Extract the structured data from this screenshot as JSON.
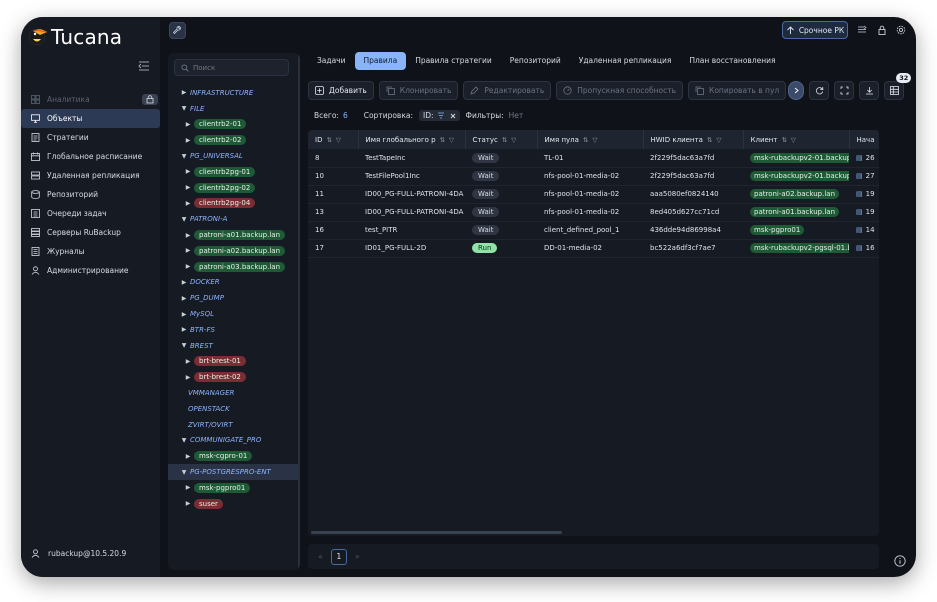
{
  "app": {
    "name": "Tucana"
  },
  "sidebar": {
    "items": [
      {
        "label": "Аналитика",
        "icon": "analytics-icon",
        "disabled": true
      },
      {
        "label": "Объекты",
        "icon": "monitor-icon",
        "active": true
      },
      {
        "label": "Стратегии",
        "icon": "document-icon"
      },
      {
        "label": "Глобальное расписание",
        "icon": "calendar-icon"
      },
      {
        "label": "Удаленная репликация",
        "icon": "server-icon"
      },
      {
        "label": "Репозиторий",
        "icon": "database-icon"
      },
      {
        "label": "Очереди задач",
        "icon": "queue-icon"
      },
      {
        "label": "Серверы RuBackup",
        "icon": "servers-icon"
      },
      {
        "label": "Журналы",
        "icon": "log-icon"
      },
      {
        "label": "Администрирование",
        "icon": "admin-icon"
      }
    ],
    "user": "rubackup@10.5.20.9"
  },
  "topbar": {
    "urgent_label": "Срочное РК"
  },
  "tree": {
    "search_placeholder": "Поиск",
    "nodes": [
      {
        "type": "group",
        "label": "INFRASTRUCTURE",
        "expanded": false
      },
      {
        "type": "group",
        "label": "FILE",
        "expanded": true
      },
      {
        "type": "child",
        "label": "clientrb2-01",
        "color": "green"
      },
      {
        "type": "child",
        "label": "clientrb2-02",
        "color": "green"
      },
      {
        "type": "group",
        "label": "PG_UNIVERSAL",
        "expanded": true
      },
      {
        "type": "child",
        "label": "clientrb2pg-01",
        "color": "green"
      },
      {
        "type": "child",
        "label": "clientrb2pg-02",
        "color": "green"
      },
      {
        "type": "child",
        "label": "clientrb2pg-04",
        "color": "red"
      },
      {
        "type": "group",
        "label": "PATRONI-A",
        "expanded": true
      },
      {
        "type": "child",
        "label": "patroni-a01.backup.lan",
        "color": "green"
      },
      {
        "type": "child",
        "label": "patroni-a02.backup.lan",
        "color": "green"
      },
      {
        "type": "child",
        "label": "patroni-a03.backup.lan",
        "color": "green"
      },
      {
        "type": "group",
        "label": "DOCKER",
        "expanded": false
      },
      {
        "type": "group",
        "label": "PG_DUMP",
        "expanded": false
      },
      {
        "type": "group",
        "label": "MySQL",
        "expanded": false
      },
      {
        "type": "group",
        "label": "BTR-FS",
        "expanded": false
      },
      {
        "type": "group",
        "label": "BREST",
        "expanded": true
      },
      {
        "type": "child",
        "label": "brt-brest-01",
        "color": "red"
      },
      {
        "type": "child",
        "label": "brt-brest-02",
        "color": "red"
      },
      {
        "type": "leaf",
        "label": "VMMANAGER"
      },
      {
        "type": "leaf",
        "label": "OPENSTACK"
      },
      {
        "type": "leaf",
        "label": "ZVIRT/OVIRT"
      },
      {
        "type": "group",
        "label": "COMMUNIGATE_PRO",
        "expanded": true
      },
      {
        "type": "child",
        "label": "msk-cgpro-01",
        "color": "green"
      },
      {
        "type": "group",
        "label": "PG-POSTGRESPRO-ENT",
        "expanded": true,
        "selected": true
      },
      {
        "type": "child",
        "label": "msk-pgpro01",
        "color": "green"
      },
      {
        "type": "child",
        "label": "suser",
        "color": "red"
      }
    ]
  },
  "tabs": [
    {
      "label": "Задачи"
    },
    {
      "label": "Правила",
      "active": true
    },
    {
      "label": "Правила стратегии"
    },
    {
      "label": "Репозиторий"
    },
    {
      "label": "Удаленная репликация"
    },
    {
      "label": "План восстановления"
    }
  ],
  "toolbar": {
    "add": "Добавить",
    "clone": "Клонировать",
    "edit": "Редактировать",
    "bandwidth": "Пропускная способность",
    "copy_to_pool": "Копировать в пул",
    "count_badge": "32"
  },
  "summary": {
    "total_label": "Всего:",
    "total_value": "6",
    "sort_label": "Сортировка:",
    "sort_value": "ID:",
    "filters_label": "Фильтры:",
    "filters_value": "Нет"
  },
  "table": {
    "columns": [
      "ID",
      "Имя глобального р",
      "Статус",
      "Имя пула",
      "HWID клиента",
      "Клиент",
      "Нача"
    ],
    "rows": [
      [
        "8",
        "TestTapeInc",
        "Wait",
        "TL-01",
        "2f229f5dac63a7fd",
        "msk-rubackupv2-01.backup.",
        "26"
      ],
      [
        "10",
        "TestFilePool1Inc",
        "Wait",
        "nfs-pool-01-media-02",
        "2f229f5dac63a7fd",
        "msk-rubackupv2-01.backup.",
        "27"
      ],
      [
        "11",
        "ID00_PG-FULL-PATRONI-4DA",
        "Wait",
        "nfs-pool-01-media-02",
        "aaa5080ef0824140",
        "patroni-a02.backup.lan",
        "19"
      ],
      [
        "13",
        "ID00_PG-FULL-PATRONI-4DA",
        "Wait",
        "nfs-pool-01-media-02",
        "8ed405d627cc71cd",
        "patroni-a01.backup.lan",
        "19"
      ],
      [
        "16",
        "test_PITR",
        "Wait",
        "client_defined_pool_1",
        "436dde94d86998a4",
        "msk-pgpro01",
        "14"
      ],
      [
        "17",
        "ID01_PG-FULL-2D",
        "Run",
        "DD-01-media-02",
        "bc522a6df3cf7ae7",
        "msk-rubackupv2-pgsql-01.b",
        "16"
      ]
    ]
  },
  "pager": {
    "current": "1",
    "prev": "«",
    "next": "»"
  }
}
